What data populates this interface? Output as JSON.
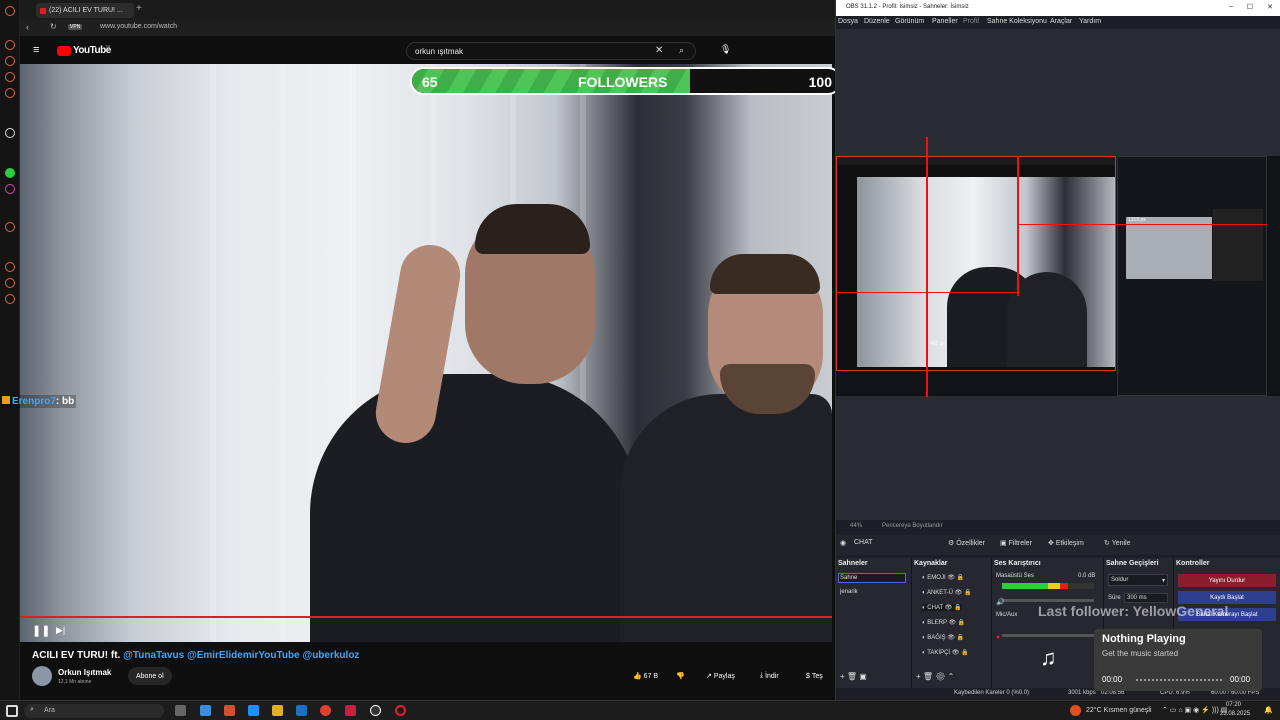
{
  "browser": {
    "tab_title": "(22) ACILI EV TURU! ...",
    "url": "www.youtube.com/watch",
    "vpn_badge": "VPN"
  },
  "youtube": {
    "logo": "YouTube",
    "logo_country": "TR",
    "search_query": "orkun ışıtmak",
    "video_title": "ACILI EV TURU! ft.",
    "video_title_mentions": "@TunaTavus @EmirElidemirYouTube @uberkuloz",
    "channel_name": "Orkun Işıtmak",
    "subscribers": "12,1 Mn abone",
    "subscribe_label": "Abone ol",
    "likes": "67 B",
    "share_label": "Paylaş",
    "download_label": "İndir",
    "more_label": "Teş",
    "progress_fraction": 1.0
  },
  "overlay": {
    "followers_current": "65",
    "followers_label": "FOLLOWERS",
    "followers_goal": "100",
    "followers_fraction": 0.65,
    "chat_user": "Erenpro7",
    "chat_message": ": bb",
    "last_follower": "Last follower: YellowGeneral",
    "music_title": "Nothing Playing",
    "music_subtitle": "Get the music started",
    "music_time_start": "00:00",
    "music_time_end": "00:00"
  },
  "obs": {
    "title": "OBS 31.1.2 - Profil: İsimsiz - Sahneler: İsimsiz",
    "menu": [
      "Dosya",
      "Düzenle",
      "Görünüm",
      "Paneller",
      "Profil",
      "Sahne Koleksiyonu",
      "Araçlar",
      "Yardım"
    ],
    "zoom": "44%",
    "fit_label": "Pencereye Boyutlandır",
    "preview_px_a": "1319 px",
    "preview_px_b": "462 px",
    "source_name": "CHAT",
    "properties_label": "Özellikler",
    "filters_label": "Filtreler",
    "interact_label": "Etkileşim",
    "refresh_label": "Yenile",
    "scenes_title": "Sahneler",
    "scenes": [
      "Sahne",
      "jenarik"
    ],
    "sources_title": "Kaynaklar",
    "sources": [
      "EMOJI",
      "ANKET-Ü",
      "CHAT",
      "BLERP",
      "BAĞIŞ",
      "TAKİPÇİ"
    ],
    "mixer_title": "Ses Karıştırıcı",
    "mixer_desktop": "Masaüstü Ses",
    "mixer_desktop_db": "0.0 dB",
    "mixer_mic": "Mic/Aux",
    "mixer_level_fraction": 0.72,
    "transitions_title": "Sahne Geçişleri",
    "transition_type": "Soldur",
    "duration_label": "Süre",
    "duration_value": "300 ms",
    "controls_title": "Kontroller",
    "stop_stream_label": "Yayını Durdur",
    "start_record_label": "Kaydı Başlat",
    "virtual_cam_label": "Sanal Kamerayı Başlat",
    "status_dropped": "Kaybedilen Kareler 0 (%0.0)",
    "status_bitrate": "3001 kbps",
    "status_time": "02:08:56",
    "status_cpu": "CPU: 6.9%",
    "status_fps": "60.00 / 60.00 FPS"
  },
  "taskbar": {
    "search_placeholder": "Ara",
    "weather": "22°C  Kısmen güneşli",
    "time": "07:20",
    "date": "23.08.2025"
  },
  "colors": {
    "red_accent": "#e02020",
    "follower_green": "#4fc458",
    "obs_stop_red": "#8b1d2c",
    "obs_record_blue": "#2d3f8e",
    "yt_blue": "#3ea6ff"
  }
}
